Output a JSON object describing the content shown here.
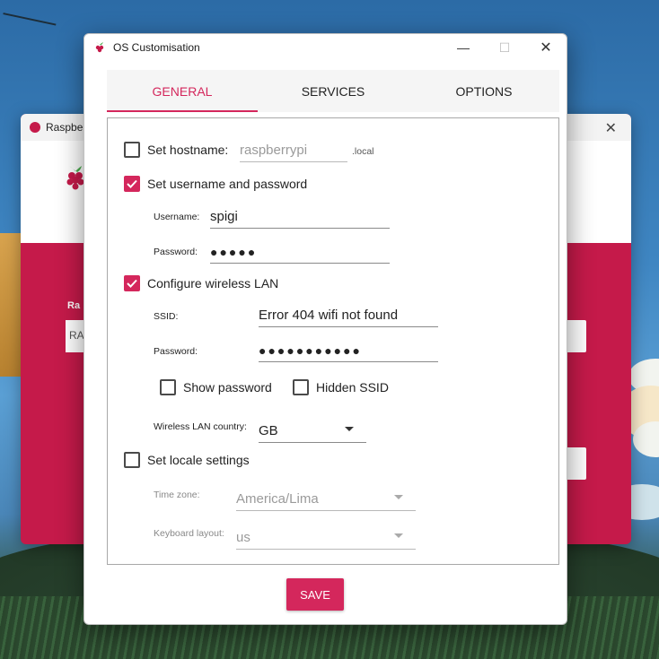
{
  "background_window": {
    "title": "Raspbe",
    "label": "Ra",
    "field_text": "RA"
  },
  "dialog": {
    "title": "OS Customisation",
    "tabs": [
      {
        "label": "GENERAL",
        "active": true
      },
      {
        "label": "SERVICES",
        "active": false
      },
      {
        "label": "OPTIONS",
        "active": false
      }
    ],
    "hostname": {
      "checkbox_label": "Set hostname:",
      "checked": false,
      "placeholder": "raspberrypi",
      "suffix": ".local"
    },
    "user": {
      "checkbox_label": "Set username and password",
      "checked": true,
      "username_label": "Username:",
      "username_value": "spigi",
      "password_label": "Password:",
      "password_value": "●●●●●"
    },
    "wifi": {
      "checkbox_label": "Configure wireless LAN",
      "checked": true,
      "ssid_label": "SSID:",
      "ssid_value": "Error 404 wifi not found",
      "password_label": "Password:",
      "password_value": "●●●●●●●●●●●",
      "show_password_label": "Show password",
      "show_password_checked": false,
      "hidden_ssid_label": "Hidden SSID",
      "hidden_ssid_checked": false,
      "country_label": "Wireless LAN country:",
      "country_value": "GB"
    },
    "locale": {
      "checkbox_label": "Set locale settings",
      "checked": false,
      "timezone_label": "Time zone:",
      "timezone_value": "America/Lima",
      "keyboard_label": "Keyboard layout:",
      "keyboard_value": "us"
    },
    "save_label": "SAVE"
  },
  "colors": {
    "accent": "#d4275c",
    "imager_red": "#c51a4a"
  }
}
